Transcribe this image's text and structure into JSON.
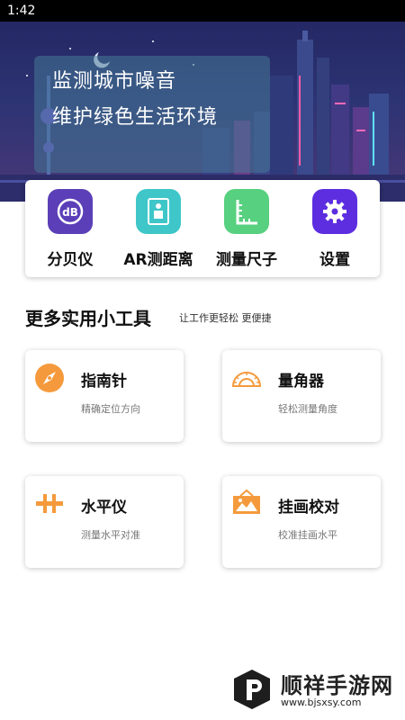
{
  "status_bar": {
    "time": "1:42"
  },
  "banner": {
    "line1": "监测城市噪音",
    "line2": "维护绿色生活环境"
  },
  "features": [
    {
      "label": "分贝仪",
      "icon": "decibel-icon",
      "color": "#5b3fb8"
    },
    {
      "label": "AR测距离",
      "icon": "ar-measure-icon",
      "color": "#3ec6c8"
    },
    {
      "label": "测量尺子",
      "icon": "ruler-icon",
      "color": "#57d07f"
    },
    {
      "label": "设置",
      "icon": "gear-icon",
      "color": "#5c2ee0"
    }
  ],
  "more_tools": {
    "title": "更多实用小工具",
    "subtitle": "让工作更轻松 更便捷"
  },
  "tools": [
    {
      "title": "指南针",
      "desc": "精确定位方向",
      "icon": "compass-icon"
    },
    {
      "title": "量角器",
      "desc": "轻松测量角度",
      "icon": "protractor-icon"
    },
    {
      "title": "水平仪",
      "desc": "测量水平对准",
      "icon": "level-icon"
    },
    {
      "title": "挂画校对",
      "desc": "校准挂画水平",
      "icon": "picture-frame-icon"
    }
  ],
  "accent_color": "#f59a3c",
  "watermark": {
    "name": "顺祥手游网",
    "url": "www.bjsxsy.com"
  }
}
